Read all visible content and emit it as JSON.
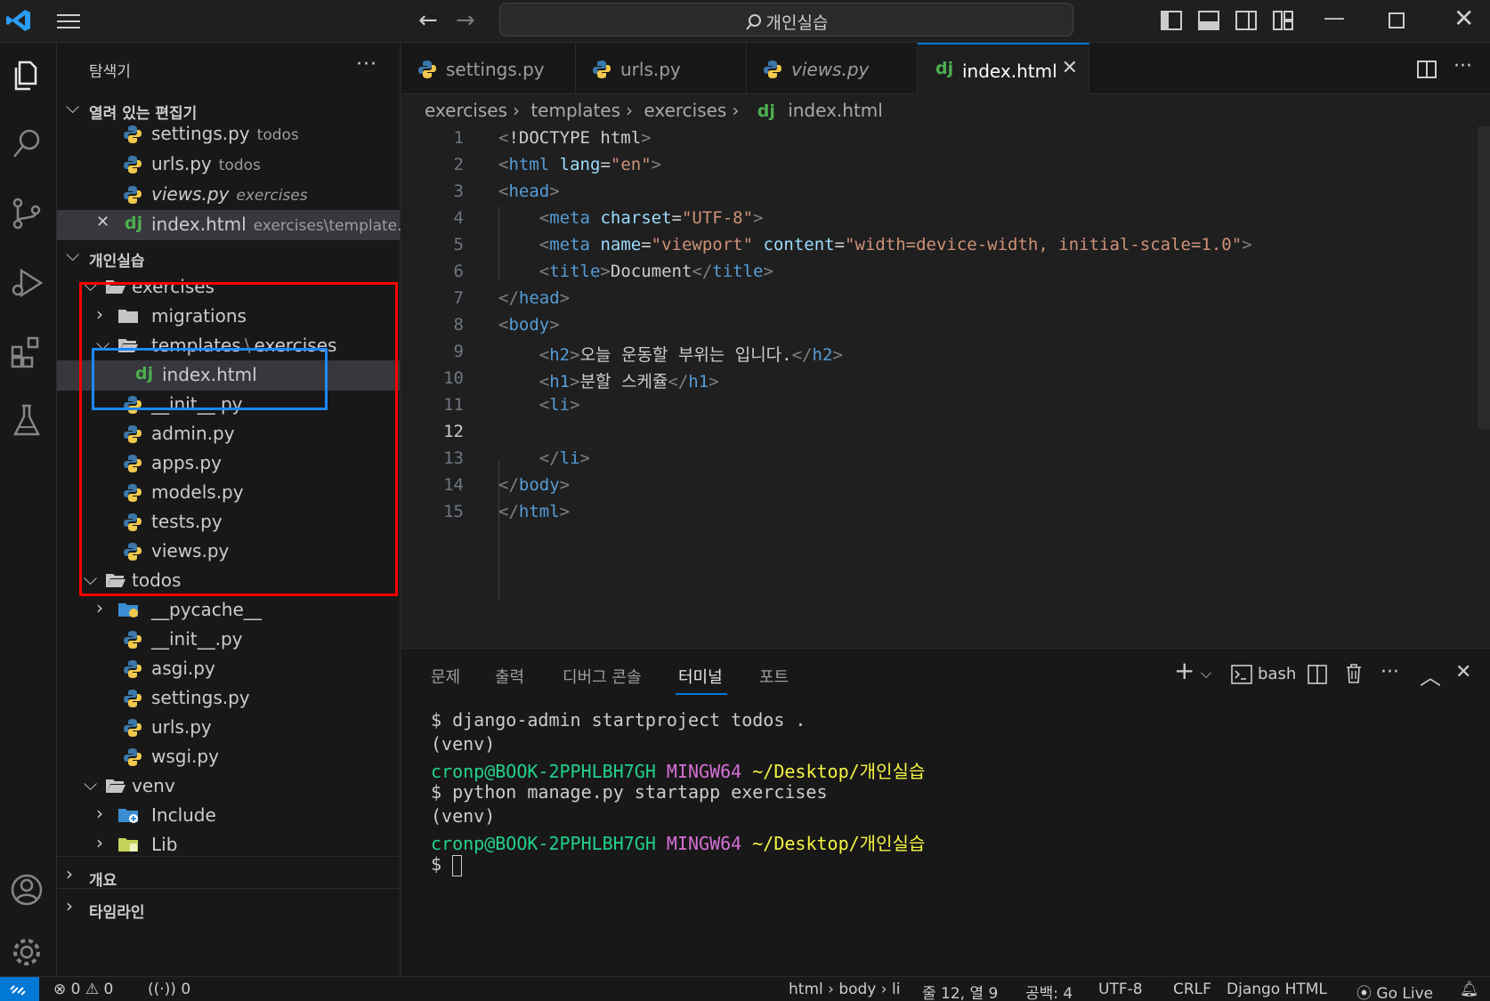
{
  "titlebar": {
    "search": "개인실습"
  },
  "sidebar": {
    "title": "탐색기",
    "more": "···",
    "open_editors": {
      "label": "열려 있는 편집기",
      "items": [
        {
          "name": "settings.py",
          "desc": "todos",
          "italic": false
        },
        {
          "name": "urls.py",
          "desc": "todos",
          "italic": false
        },
        {
          "name": "views.py",
          "desc": "exercises",
          "italic": true
        },
        {
          "name": "index.html",
          "desc": "exercises\\template...",
          "italic": false
        }
      ]
    },
    "workspace": {
      "label": "개인실습",
      "tree": [
        {
          "name": "exercises"
        },
        {
          "name": "migrations"
        },
        {
          "name": "templates",
          "sep": "\\",
          "name2": "exercises"
        },
        {
          "name": "index.html"
        },
        {
          "name": "__init__.py"
        },
        {
          "name": "admin.py"
        },
        {
          "name": "apps.py"
        },
        {
          "name": "models.py"
        },
        {
          "name": "tests.py"
        },
        {
          "name": "views.py"
        },
        {
          "name": "todos"
        },
        {
          "name": "__pycache__"
        },
        {
          "name": "__init__.py"
        },
        {
          "name": "asgi.py"
        },
        {
          "name": "settings.py"
        },
        {
          "name": "urls.py"
        },
        {
          "name": "wsgi.py"
        },
        {
          "name": "venv"
        },
        {
          "name": "Include"
        },
        {
          "name": "Lib"
        }
      ]
    },
    "outline": "개요",
    "timeline": "타임라인"
  },
  "tabs": [
    {
      "label": "settings.py"
    },
    {
      "label": "urls.py"
    },
    {
      "label": "views.py"
    },
    {
      "label": "index.html"
    }
  ],
  "breadcrumb": [
    "exercises",
    "templates",
    "exercises",
    "index.html"
  ],
  "editor": {
    "line_numbers": [
      "1",
      "2",
      "3",
      "4",
      "5",
      "6",
      "7",
      "8",
      "9",
      "10",
      "11",
      "12",
      "13",
      "14",
      "15"
    ],
    "current_line": 12
  },
  "panel": {
    "tabs": [
      "문제",
      "출력",
      "디버그 콘솔",
      "터미널",
      "포트"
    ],
    "active_tab": "터미널",
    "shell": "bash",
    "terminal": [
      "$ django-admin startproject todos .",
      "(venv)",
      {
        "user": "cronp@BOOK-2PPHLBH7GH",
        "sys": "MINGW64",
        "path": "~/Desktop/개인실습"
      },
      "$ python manage.py startapp exercises",
      "(venv)",
      {
        "user": "cronp@BOOK-2PPHLBH7GH",
        "sys": "MINGW64",
        "path": "~/Desktop/개인실습"
      },
      "$ "
    ]
  },
  "statusbar": {
    "errors": "0",
    "warnings": "0",
    "ports": "0",
    "breadcrumb": "html › body › li",
    "position": "줄 12, 열 9",
    "spaces": "공백: 4",
    "encoding": "UTF-8",
    "eol": "CRLF",
    "language": "Django HTML",
    "golive": "Go Live"
  },
  "colors": {
    "accent": "#0078d4",
    "annotation_red": "#ff0000",
    "annotation_blue": "#1e88ff"
  }
}
